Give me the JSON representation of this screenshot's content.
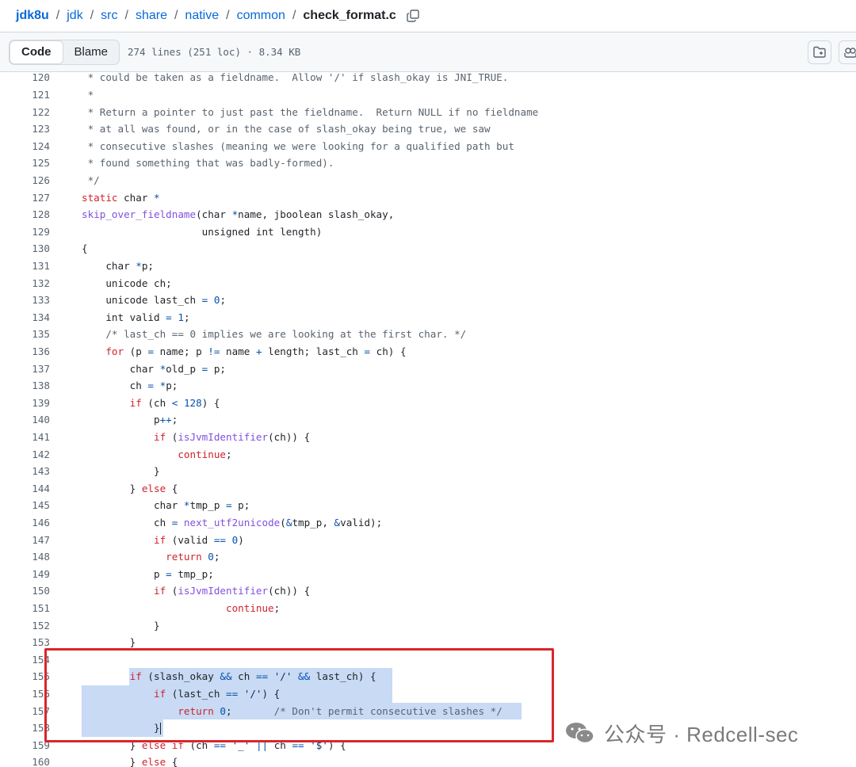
{
  "breadcrumb": {
    "items": [
      "jdk8u",
      "jdk",
      "src",
      "share",
      "native",
      "common"
    ],
    "file": "check_format.c",
    "separator": "/"
  },
  "toolbar": {
    "code_label": "Code",
    "blame_label": "Blame",
    "file_meta": "274 lines (251 loc) · 8.34 KB"
  },
  "code": {
    "line_numbers": [
      "120",
      "121",
      "122",
      "123",
      "124",
      "125",
      "126",
      "127",
      "128",
      "129",
      "130",
      "131",
      "132",
      "133",
      "134",
      "135",
      "136",
      "137",
      "138",
      "139",
      "140",
      "141",
      "142",
      "143",
      "144",
      "145",
      "146",
      "147",
      "148",
      "149",
      "150",
      "151",
      "152",
      "153",
      "154",
      "155",
      "156",
      "157",
      "158",
      "159",
      "160"
    ],
    "lines": [
      [
        [
          "cm",
          " * could be taken as a fieldname.  Allow '/' if slash_okay is JNI_TRUE."
        ]
      ],
      [
        [
          "cm",
          " *"
        ]
      ],
      [
        [
          "cm",
          " * Return a pointer to just past the fieldname.  Return NULL if no fieldname"
        ]
      ],
      [
        [
          "cm",
          " * at all was found, or in the case of slash_okay being true, we saw"
        ]
      ],
      [
        [
          "cm",
          " * consecutive slashes (meaning we were looking for a qualified path but"
        ]
      ],
      [
        [
          "cm",
          " * found something that was badly-formed)."
        ]
      ],
      [
        [
          "cm",
          " */"
        ]
      ],
      [
        [
          "k",
          "static"
        ],
        [
          "p",
          " char "
        ],
        [
          "o",
          "*"
        ]
      ],
      [
        [
          "f",
          "skip_over_fieldname"
        ],
        [
          "p",
          "(char "
        ],
        [
          "o",
          "*"
        ],
        [
          "p",
          "name, jboolean slash_okay,"
        ]
      ],
      [
        [
          "p",
          "                    unsigned int length)"
        ]
      ],
      [
        [
          "p",
          "{"
        ]
      ],
      [
        [
          "p",
          "    char "
        ],
        [
          "o",
          "*"
        ],
        [
          "p",
          "p;"
        ]
      ],
      [
        [
          "p",
          "    unicode ch;"
        ]
      ],
      [
        [
          "p",
          "    unicode last_ch "
        ],
        [
          "o",
          "="
        ],
        [
          "p",
          " "
        ],
        [
          "n",
          "0"
        ],
        [
          "p",
          ";"
        ]
      ],
      [
        [
          "p",
          "    int valid "
        ],
        [
          "o",
          "="
        ],
        [
          "p",
          " "
        ],
        [
          "n",
          "1"
        ],
        [
          "p",
          ";"
        ]
      ],
      [
        [
          "cm",
          "    /* last_ch == 0 implies we are looking at the first char. */"
        ]
      ],
      [
        [
          "p",
          "    "
        ],
        [
          "k",
          "for"
        ],
        [
          "p",
          " (p "
        ],
        [
          "o",
          "="
        ],
        [
          "p",
          " name; p "
        ],
        [
          "o",
          "!="
        ],
        [
          "p",
          " name "
        ],
        [
          "o",
          "+"
        ],
        [
          "p",
          " length; last_ch "
        ],
        [
          "o",
          "="
        ],
        [
          "p",
          " ch) {"
        ]
      ],
      [
        [
          "p",
          "        char "
        ],
        [
          "o",
          "*"
        ],
        [
          "p",
          "old_p "
        ],
        [
          "o",
          "="
        ],
        [
          "p",
          " p;"
        ]
      ],
      [
        [
          "p",
          "        ch "
        ],
        [
          "o",
          "="
        ],
        [
          "p",
          " "
        ],
        [
          "o",
          "*"
        ],
        [
          "p",
          "p;"
        ]
      ],
      [
        [
          "p",
          "        "
        ],
        [
          "k",
          "if"
        ],
        [
          "p",
          " (ch "
        ],
        [
          "o",
          "<"
        ],
        [
          "p",
          " "
        ],
        [
          "n",
          "128"
        ],
        [
          "p",
          ") {"
        ]
      ],
      [
        [
          "p",
          "            p"
        ],
        [
          "o",
          "++"
        ],
        [
          "p",
          ";"
        ]
      ],
      [
        [
          "p",
          "            "
        ],
        [
          "k",
          "if"
        ],
        [
          "p",
          " ("
        ],
        [
          "f",
          "isJvmIdentifier"
        ],
        [
          "p",
          "(ch)) {"
        ]
      ],
      [
        [
          "p",
          "                "
        ],
        [
          "k",
          "continue"
        ],
        [
          "p",
          ";"
        ]
      ],
      [
        [
          "p",
          "            }"
        ]
      ],
      [
        [
          "p",
          "        } "
        ],
        [
          "k",
          "else"
        ],
        [
          "p",
          " {"
        ]
      ],
      [
        [
          "p",
          "            char "
        ],
        [
          "o",
          "*"
        ],
        [
          "p",
          "tmp_p "
        ],
        [
          "o",
          "="
        ],
        [
          "p",
          " p;"
        ]
      ],
      [
        [
          "p",
          "            ch "
        ],
        [
          "o",
          "="
        ],
        [
          "p",
          " "
        ],
        [
          "f",
          "next_utf2unicode"
        ],
        [
          "p",
          "("
        ],
        [
          "o",
          "&"
        ],
        [
          "p",
          "tmp_p, "
        ],
        [
          "o",
          "&"
        ],
        [
          "p",
          "valid);"
        ]
      ],
      [
        [
          "p",
          "            "
        ],
        [
          "k",
          "if"
        ],
        [
          "p",
          " (valid "
        ],
        [
          "o",
          "=="
        ],
        [
          "p",
          " "
        ],
        [
          "n",
          "0"
        ],
        [
          "p",
          ")"
        ]
      ],
      [
        [
          "p",
          "              "
        ],
        [
          "k",
          "return"
        ],
        [
          "p",
          " "
        ],
        [
          "n",
          "0"
        ],
        [
          "p",
          ";"
        ]
      ],
      [
        [
          "p",
          "            p "
        ],
        [
          "o",
          "="
        ],
        [
          "p",
          " tmp_p;"
        ]
      ],
      [
        [
          "p",
          "            "
        ],
        [
          "k",
          "if"
        ],
        [
          "p",
          " ("
        ],
        [
          "f",
          "isJvmIdentifier"
        ],
        [
          "p",
          "(ch)) {"
        ]
      ],
      [
        [
          "p",
          "                        "
        ],
        [
          "k",
          "continue"
        ],
        [
          "p",
          ";"
        ]
      ],
      [
        [
          "p",
          "            }"
        ]
      ],
      [
        [
          "p",
          "        }"
        ]
      ],
      [
        [
          "p",
          ""
        ]
      ],
      [
        [
          "p",
          "        "
        ],
        [
          "k",
          "if"
        ],
        [
          "p",
          " (slash_okay "
        ],
        [
          "o",
          "&&"
        ],
        [
          "p",
          " ch "
        ],
        [
          "o",
          "=="
        ],
        [
          "p",
          " "
        ],
        [
          "s",
          "'/'"
        ],
        [
          "p",
          " "
        ],
        [
          "o",
          "&&"
        ],
        [
          "p",
          " last_ch) {"
        ]
      ],
      [
        [
          "p",
          "            "
        ],
        [
          "k",
          "if"
        ],
        [
          "p",
          " (last_ch "
        ],
        [
          "o",
          "=="
        ],
        [
          "p",
          " "
        ],
        [
          "s",
          "'/'"
        ],
        [
          "p",
          ") {"
        ]
      ],
      [
        [
          "p",
          "                "
        ],
        [
          "k",
          "return"
        ],
        [
          "p",
          " "
        ],
        [
          "n",
          "0"
        ],
        [
          "p",
          ";"
        ],
        [
          "cm",
          "       /* Don't permit consecutive slashes */"
        ]
      ],
      [
        [
          "p",
          "            }"
        ]
      ],
      [
        [
          "p",
          "        } "
        ],
        [
          "k",
          "else if"
        ],
        [
          "p",
          " (ch "
        ],
        [
          "o",
          "=="
        ],
        [
          "p",
          " "
        ],
        [
          "s",
          "'_'"
        ],
        [
          "p",
          " "
        ],
        [
          "o",
          "||"
        ],
        [
          "p",
          " ch "
        ],
        [
          "o",
          "=="
        ],
        [
          "p",
          " "
        ],
        [
          "s",
          "'$'"
        ],
        [
          "p",
          ") {"
        ]
      ],
      [
        [
          "p",
          "        } "
        ],
        [
          "k",
          "else"
        ],
        [
          "p",
          " {"
        ]
      ]
    ]
  },
  "watermark": {
    "text": "公众号 · Redcell-sec"
  },
  "colors": {
    "link": "#0969da",
    "keyword": "#cf222e",
    "function": "#8250df",
    "number": "#0550ae",
    "comment": "#59636e",
    "selection": "#c8daf4",
    "highlight_box": "#d9262c"
  }
}
